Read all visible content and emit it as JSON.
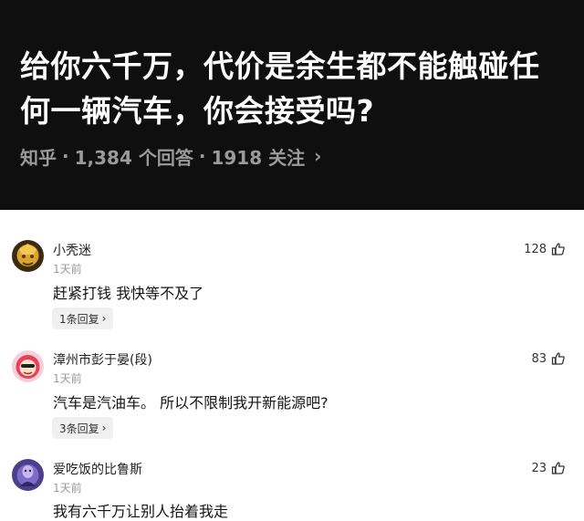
{
  "question": {
    "title": "给你六千万，代价是余生都不能触碰任何一辆汽车，你会接受吗?",
    "meta": {
      "source": "知乎",
      "dot1": "·",
      "answers": "1,384 个回答",
      "dot2": "·",
      "followers": "1918 关注",
      "chevron": "›"
    }
  },
  "comments": [
    {
      "username": "小秃迷",
      "time": "1天前",
      "text": "赶紧打钱  我快等不及了",
      "reply": "1条回复",
      "likes": "128"
    },
    {
      "username": "漳州市彭于晏(段)",
      "time": "1天前",
      "text": "汽车是汽油车。 所以不限制我开新能源吧?",
      "reply": "3条回复",
      "likes": "83"
    },
    {
      "username": "爱吃饭的比鲁斯",
      "time": "1天前",
      "text": "我有六千万让别人抬着我走",
      "likes": "23"
    }
  ],
  "icons": {
    "like": "thumbs-up-icon",
    "reply_arrow": "chevron-right-icon"
  }
}
